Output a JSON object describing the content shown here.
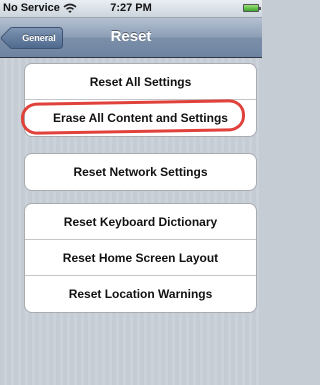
{
  "status_bar": {
    "carrier": "No Service",
    "time": "7:27 PM"
  },
  "nav": {
    "back_label": "General",
    "title": "Reset"
  },
  "groups": [
    {
      "items": [
        "Reset All Settings",
        "Erase All Content and Settings"
      ]
    },
    {
      "items": [
        "Reset Network Settings"
      ]
    },
    {
      "items": [
        "Reset Keyboard Dictionary",
        "Reset Home Screen Layout",
        "Reset Location Warnings"
      ]
    }
  ],
  "colors": {
    "highlight": "#e0413a",
    "nav_bar": "#6d84a2",
    "background": "#c5ccd4"
  }
}
